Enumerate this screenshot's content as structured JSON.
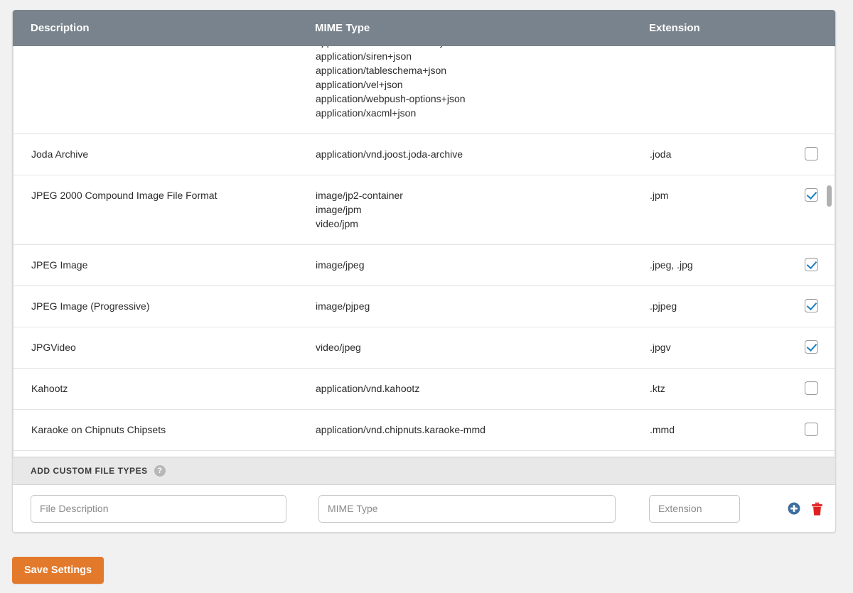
{
  "table": {
    "columns": {
      "description": "Description",
      "mime_type": "MIME Type",
      "extension": "Extension"
    },
    "rows": [
      {
        "description": "",
        "mime_type": "application/schema+json\napplication/oracle.resource+json\napplication/siren+json\napplication/tableschema+json\napplication/vel+json\napplication/webpush-options+json\napplication/xacml+json",
        "extension": "",
        "enabled": false,
        "clipped": true
      },
      {
        "description": "Joda Archive",
        "mime_type": "application/vnd.joost.joda-archive",
        "extension": ".joda",
        "enabled": false
      },
      {
        "description": "JPEG 2000 Compound Image File Format",
        "mime_type": "image/jp2-container\nimage/jpm\nvideo/jpm",
        "extension": ".jpm",
        "enabled": true
      },
      {
        "description": "JPEG Image",
        "mime_type": "image/jpeg",
        "extension": ".jpeg, .jpg",
        "enabled": true
      },
      {
        "description": "JPEG Image (Progressive)",
        "mime_type": "image/pjpeg",
        "extension": ".pjpeg",
        "enabled": true
      },
      {
        "description": "JPGVideo",
        "mime_type": "video/jpeg",
        "extension": ".jpgv",
        "enabled": true
      },
      {
        "description": "Kahootz",
        "mime_type": "application/vnd.kahootz",
        "extension": ".ktz",
        "enabled": false
      },
      {
        "description": "Karaoke on Chipnuts Chipsets",
        "mime_type": "application/vnd.chipnuts.karaoke-mmd",
        "extension": ".mmd",
        "enabled": false
      }
    ]
  },
  "add_custom": {
    "title": "ADD CUSTOM FILE TYPES",
    "help_glyph": "?",
    "help_icon": "question-mark-circle-icon",
    "description_placeholder": "File Description",
    "description_value": "",
    "mime_placeholder": "MIME Type",
    "mime_value": "",
    "extension_placeholder": "Extension",
    "extension_value": "",
    "add_icon": "plus-circle-icon",
    "delete_icon": "trash-icon"
  },
  "footer": {
    "save_label": "Save Settings"
  },
  "colors": {
    "header_bar": "#79838d",
    "save_button": "#e3792b",
    "checkbox_check": "#1a7fc1",
    "add_icon": "#3e6e9e",
    "delete_icon": "#e02020",
    "page_background": "#f1f1f1",
    "section_background": "#e8e8e8"
  }
}
